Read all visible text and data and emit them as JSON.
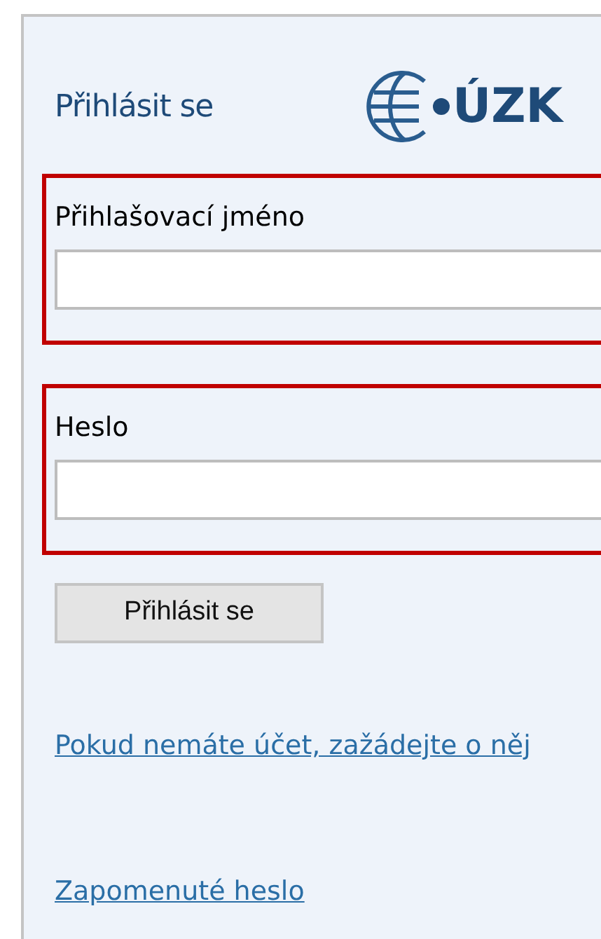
{
  "header": {
    "title": "Přihlásit se",
    "logo_text": "ÚZK"
  },
  "fields": [
    {
      "label": "Přihlašovací jméno"
    },
    {
      "label": "Heslo"
    }
  ],
  "submit_button": "Přihlásit se",
  "links": [
    "Pokud nemáte účet, zažádejte o něj",
    "Zapomenuté heslo"
  ]
}
